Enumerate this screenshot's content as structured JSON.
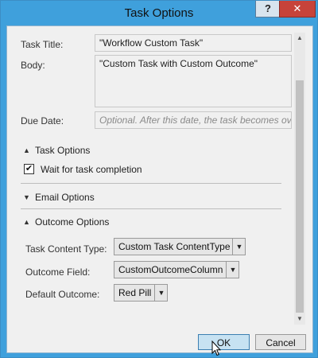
{
  "window": {
    "title": "Task Options",
    "help_label": "?",
    "close_label": "✕"
  },
  "form": {
    "task_title_label": "Task Title:",
    "task_title_value": "\"Workflow Custom Task\"",
    "body_label": "Body:",
    "body_value": "\"Custom Task with Custom Outcome\"",
    "due_date_label": "Due Date:",
    "due_date_placeholder": "Optional. After this date, the task becomes over"
  },
  "sections": {
    "task_options": {
      "label": "Task Options",
      "expanded": true
    },
    "wait_checkbox": {
      "label": "Wait for task completion",
      "checked": true
    },
    "email_options": {
      "label": "Email Options",
      "expanded": false
    },
    "outcome_options": {
      "label": "Outcome Options",
      "expanded": true
    }
  },
  "outcome": {
    "content_type_label": "Task Content Type:",
    "content_type_value": "Custom Task ContentType",
    "outcome_field_label": "Outcome Field:",
    "outcome_field_value": "CustomOutcomeColumn",
    "default_outcome_label": "Default Outcome:",
    "default_outcome_value": "Red Pill"
  },
  "buttons": {
    "ok": "OK",
    "cancel": "Cancel"
  },
  "icons": {
    "expanded_caret": "caret-up-icon",
    "collapsed_caret": "caret-down-icon",
    "dropdown_arrow": "chevron-down-icon",
    "checkmark": "check-icon"
  }
}
